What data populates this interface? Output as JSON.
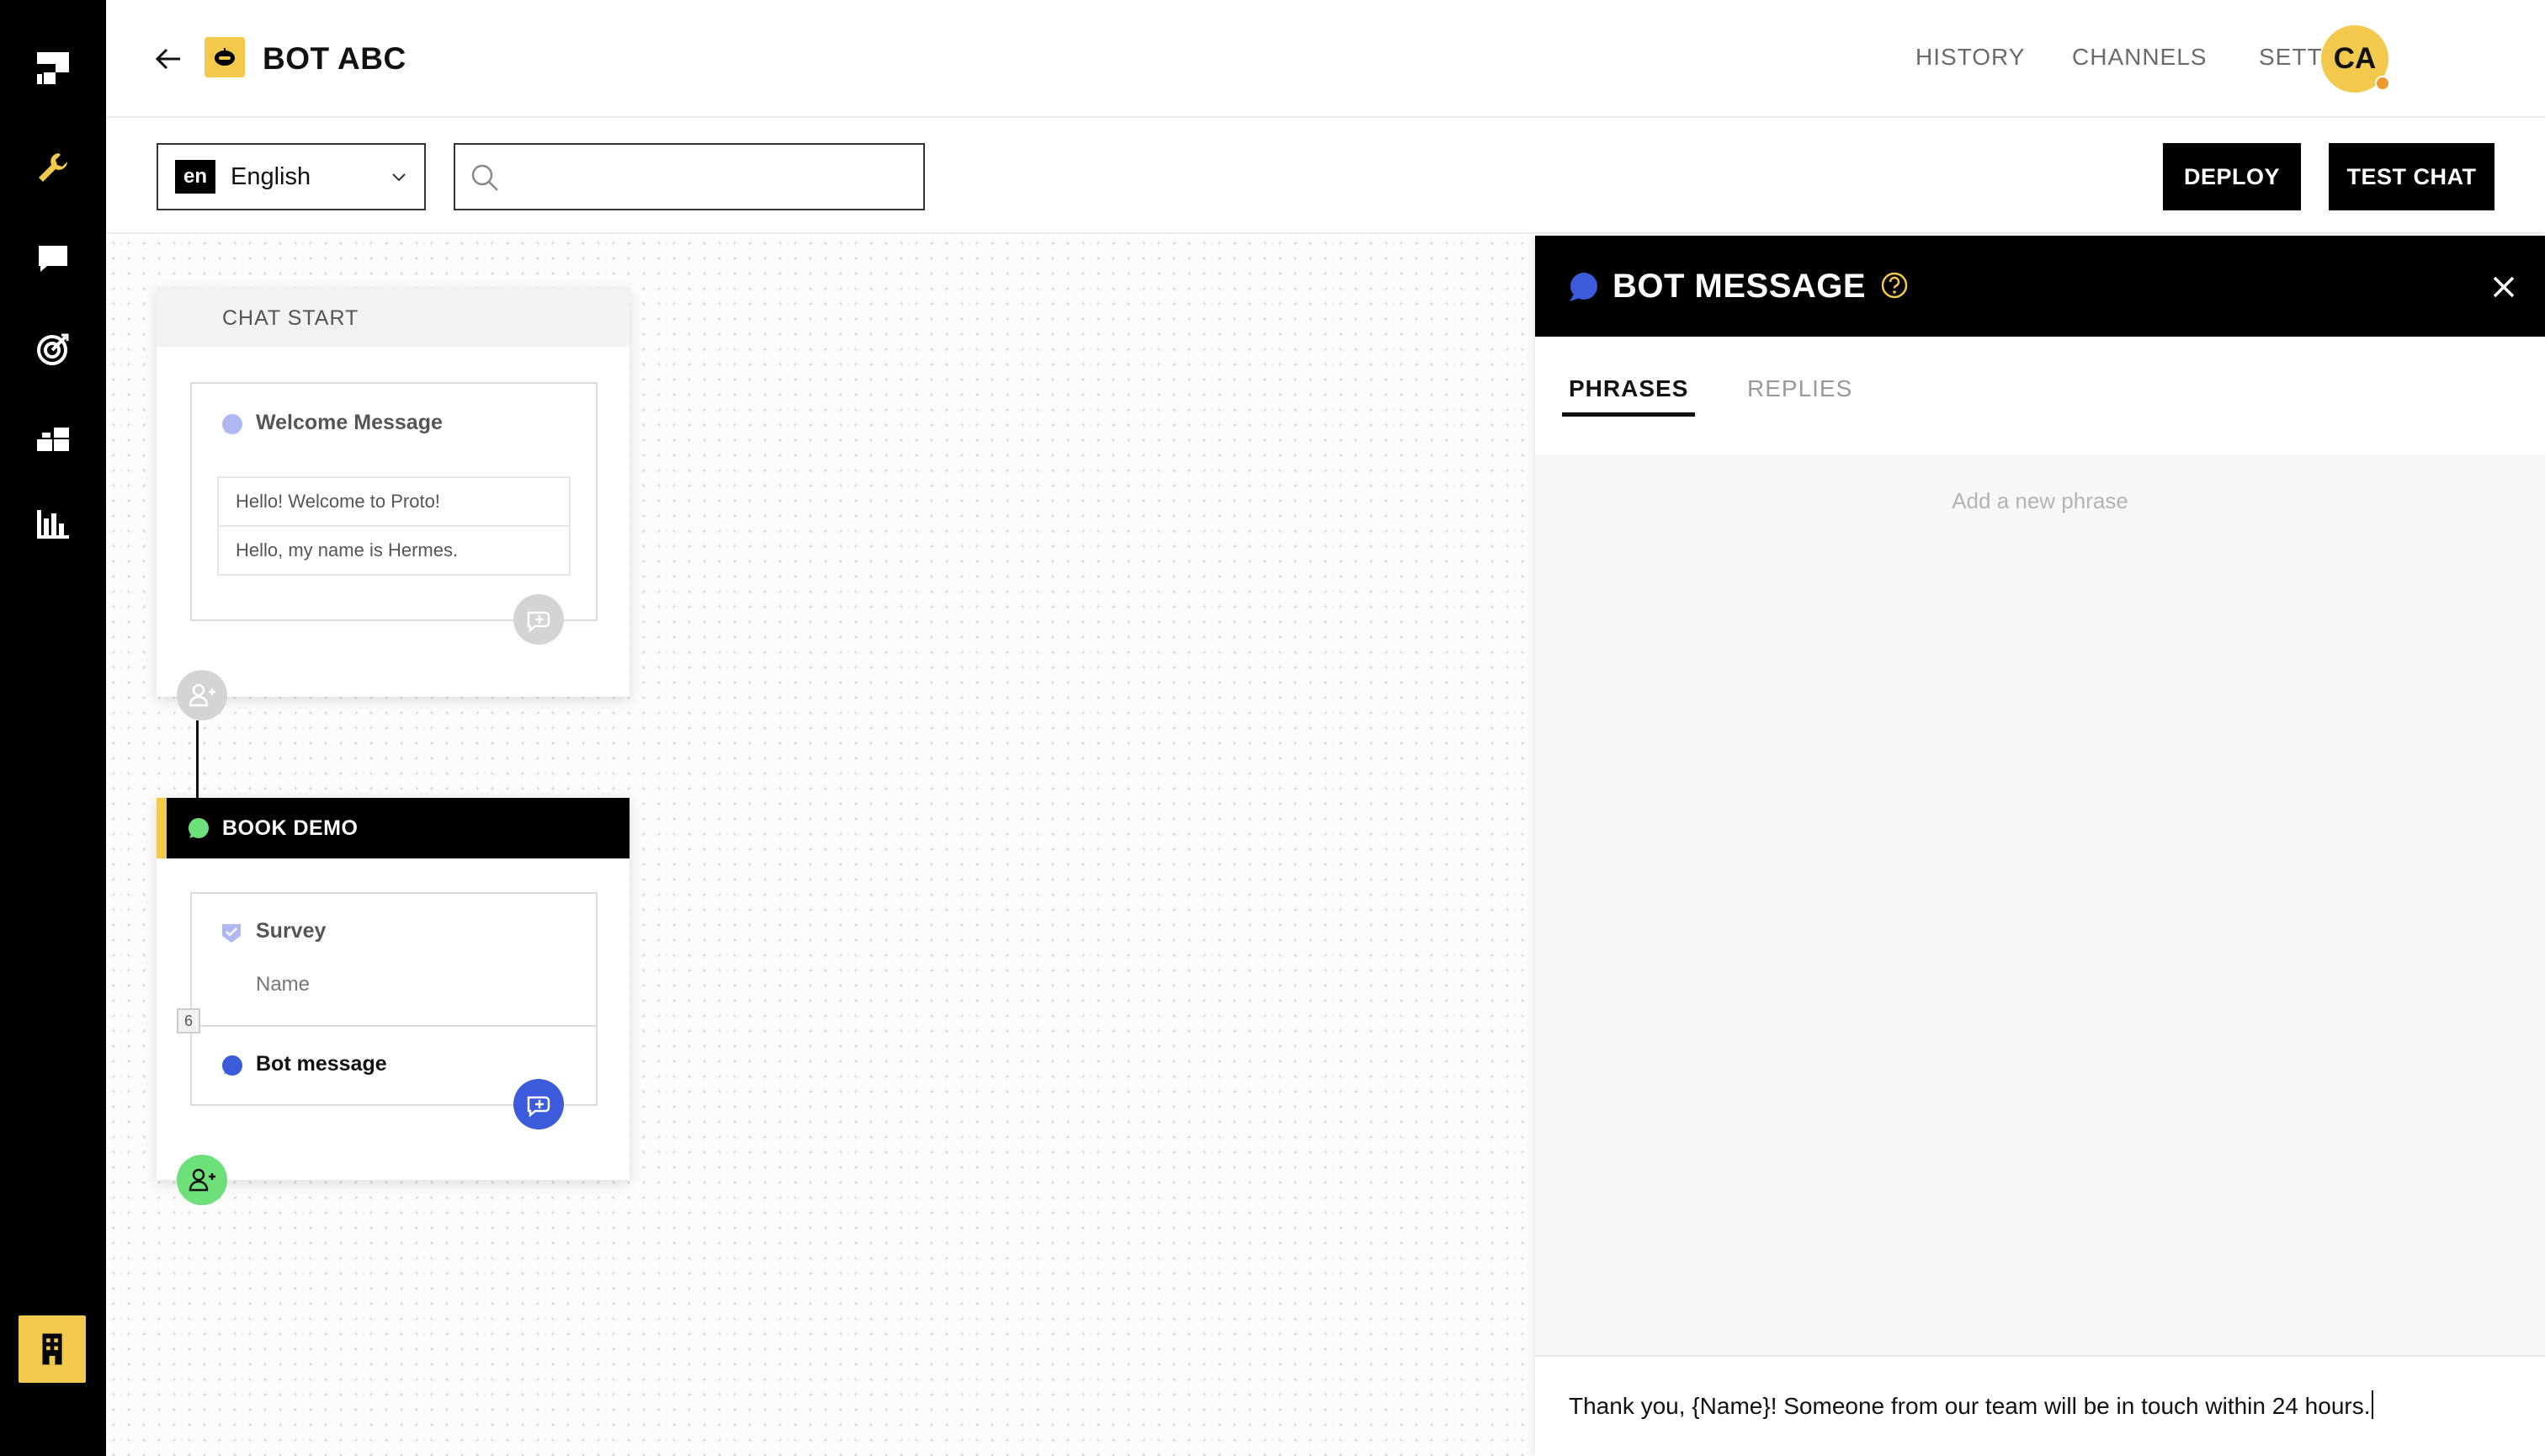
{
  "app": {
    "bot_name": "BOT ABC"
  },
  "sidebar": {
    "items": [
      {
        "icon": "proto-logo-icon"
      },
      {
        "icon": "wrench-icon"
      },
      {
        "icon": "chat-bubble-icon"
      },
      {
        "icon": "target-icon"
      },
      {
        "icon": "blocks-icon"
      },
      {
        "icon": "bar-chart-icon"
      }
    ],
    "bottom_icon": "building-icon"
  },
  "header": {
    "nav": [
      "HISTORY",
      "CHANNELS",
      "SETTINGS"
    ],
    "avatar_initials": "CA"
  },
  "toolbar": {
    "language_code": "en",
    "language_name": "English",
    "search_placeholder": "",
    "deploy_label": "DEPLOY",
    "test_chat_label": "TEST CHAT"
  },
  "canvas": {
    "chat_start": {
      "title": "CHAT START",
      "message_title": "Welcome Message",
      "phrases": [
        "Hello! Welcome to Proto!",
        "Hello, my name is Hermes."
      ]
    },
    "book_demo": {
      "title": "BOOK DEMO",
      "survey_title": "Survey",
      "survey_field": "Name",
      "step_count": "6",
      "bot_message_title": "Bot message"
    }
  },
  "panel": {
    "title": "BOT MESSAGE",
    "tabs": [
      "PHRASES",
      "REPLIES"
    ],
    "active_tab": "PHRASES",
    "add_phrase": "Add a new phrase",
    "composer_text": "Thank you, {Name}! Someone from our team will be in touch within 24 hours."
  },
  "colors": {
    "accent_yellow": "#f2c94c",
    "message_blue": "#3b5bdb",
    "success_green": "#6ee07a",
    "black": "#000000"
  }
}
